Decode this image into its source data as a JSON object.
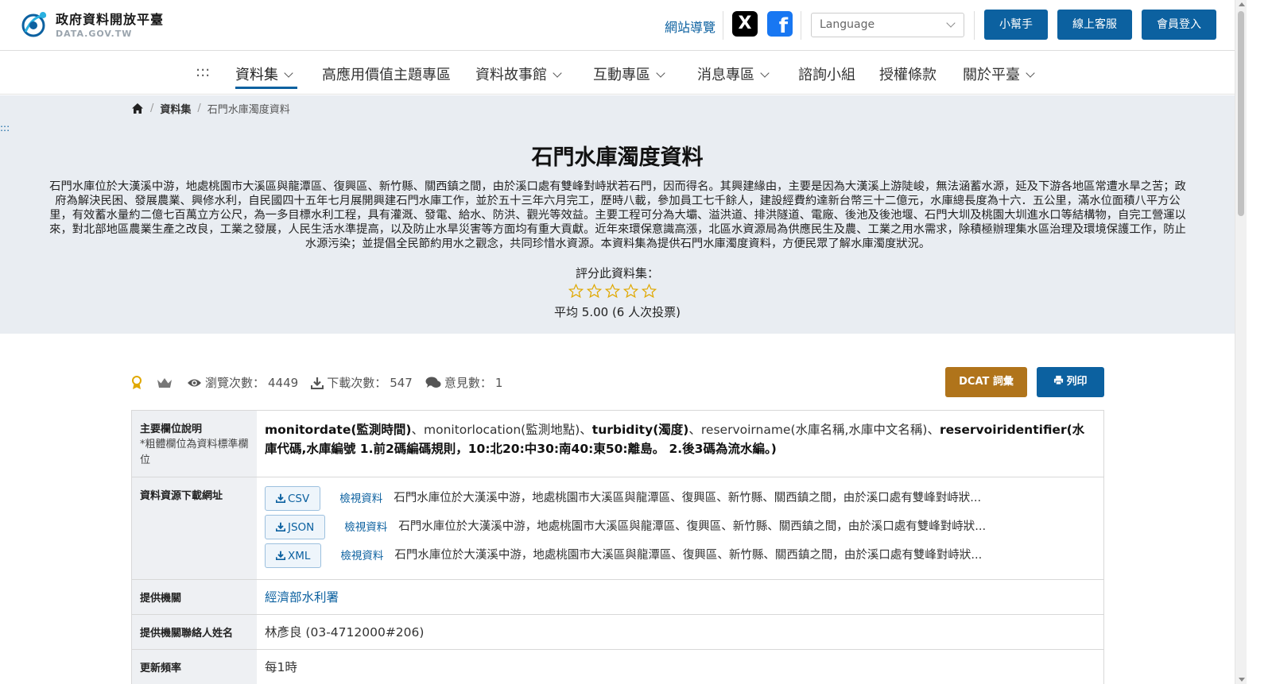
{
  "header": {
    "logo_title": "政府資料開放平臺",
    "logo_sub": "DATA.GOV.TW",
    "sitemap": "網站導覽",
    "x_label": "X",
    "fb_label": "f",
    "language_placeholder": "Language",
    "btn_helper": "小幫手",
    "btn_service": "線上客服",
    "btn_login": "會員登入"
  },
  "nav": {
    "dots": ":::",
    "items": [
      {
        "label": "資料集"
      },
      {
        "label": "高應用價值主題專區"
      },
      {
        "label": "資料故事館"
      },
      {
        "label": "互動專區"
      },
      {
        "label": "消息專區"
      },
      {
        "label": "諮詢小組"
      },
      {
        "label": "授權條款"
      },
      {
        "label": "關於平臺"
      }
    ]
  },
  "breadcrumb": {
    "sep": "/",
    "level1": "資料集",
    "current": "石門水庫濁度資料"
  },
  "side_dots": ":::",
  "page": {
    "title": "石門水庫濁度資料",
    "description": "石門水庫位於大漢溪中游，地處桃園市大溪區與龍潭區、復興區、新竹縣、關西鎮之間，由於溪口處有雙峰對峙狀若石門，因而得名。其興建緣由，主要是因為大漢溪上游陡峻，無法涵蓄水源，延及下游各地區常遭水旱之苦；政府為解決民困、發展農業、興修水利，自民國四十五年七月展開興建石門水庫工作，並於五十三年六月完工，歷時八載，參加員工七千餘人，建設經費約達新台幣三十二億元，水庫總長度為十六．五公里，滿水位面積八平方公里，有效蓄水量約二億七百萬立方公尺，為一多目標水利工程，具有灌溉、發電、給水、防洪、觀光等效益。主要工程可分為大壩、溢洪道、排洪隧道、電廠、後池及後池堰、石門大圳及桃園大圳進水口等結構物，自完工營運以來，對北部地區農業生產之改良，工業之發展，人民生活水準提高，以及防止水旱災害等方面均有重大貢獻。近年來環保意識高漲，北區水資源局為供應民生及農、工業之用水需求，除積極辦理集水區治理及環境保護工作，防止水源污染；並提倡全民節約用水之觀念，共同珍惜水資源。本資料集為提供石門水庫濁度資料，方便民眾了解水庫濁度狀況。",
    "rate_label": "評分此資料集：",
    "rating_filled_stars": 0,
    "rate_avg": "平均 5.00 (6 人次投票)"
  },
  "stats": {
    "views_label": "瀏覽次數：",
    "views": "4449",
    "downloads_label": "下載次數：",
    "downloads": "547",
    "comments_label": "意見數：",
    "comments": "1",
    "btn_dcat": "DCAT 詞彙",
    "btn_print": "列印"
  },
  "table": {
    "fields_label": "主要欄位說明",
    "fields_note": "*粗體欄位為資料標準欄位",
    "fields": {
      "f1": "monitordate(監測時間)",
      "s1": "、",
      "f2": "monitorlocation(監測地點)",
      "s2": "、",
      "f3": "turbidity(濁度)",
      "s3": "、",
      "f4": "reservoirname(水庫名稱,水庫中文名稱)",
      "s4": "、",
      "f5": "reservoiridentifier(水庫代碼,水庫編號 1.前2碼編碼規則，10:北20:中30:南40:東50:離島。 2.後3碼為流水編。)"
    },
    "resources_label": "資料資源下載網址",
    "resources": [
      {
        "format": "CSV",
        "view": "檢視資料",
        "desc": "石門水庫位於大漢溪中游，地處桃園市大溪區與龍潭區、復興區、新竹縣、關西鎮之間，由於溪口處有雙峰對峙狀..."
      },
      {
        "format": "JSON",
        "view": "檢視資料",
        "desc": "石門水庫位於大漢溪中游，地處桃園市大溪區與龍潭區、復興區、新竹縣、關西鎮之間，由於溪口處有雙峰對峙狀..."
      },
      {
        "format": "XML",
        "view": "檢視資料",
        "desc": "石門水庫位於大漢溪中游，地處桃園市大溪區與龍潭區、復興區、新竹縣、關西鎮之間，由於溪口處有雙峰對峙狀..."
      }
    ],
    "provider_label": "提供機關",
    "provider": "經濟部水利署",
    "contact_label": "提供機關聯絡人姓名",
    "contact": "林彥良 (03-4712000#206)",
    "frequency_label": "更新頻率",
    "frequency": "每1時"
  },
  "colors": {
    "primary": "#0c61a0",
    "dcat": "#b0741b",
    "banner_bg": "#e9edf2",
    "star": "#e0a800"
  },
  "icons": [
    "home-icon",
    "x-icon",
    "facebook-icon",
    "chevron-down-icon",
    "medal-icon",
    "crown-icon",
    "eye-icon",
    "download-icon",
    "comments-icon",
    "printer-icon",
    "star-icon"
  ]
}
